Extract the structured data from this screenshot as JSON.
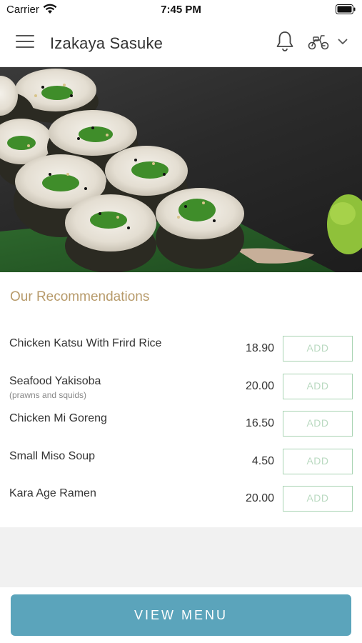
{
  "status_bar": {
    "carrier": "Carrier",
    "time": "7:45 PM"
  },
  "header": {
    "title": "Izakaya Sasuke",
    "icons": [
      "menu-icon",
      "bell-icon",
      "scooter-icon",
      "chevron-down-icon"
    ]
  },
  "recommendations": {
    "title": "Our Recommendations",
    "add_label": "ADD",
    "items": [
      {
        "name": "Chicken Katsu With Frird Rice",
        "subtitle": "",
        "price": "18.90"
      },
      {
        "name": "Seafood Yakisoba",
        "subtitle": "(prawns and squids)",
        "price": "20.00"
      },
      {
        "name": "Chicken Mi Goreng",
        "subtitle": "",
        "price": "16.50"
      },
      {
        "name": "Small Miso Soup",
        "subtitle": "",
        "price": "4.50"
      },
      {
        "name": "Kara Age Ramen",
        "subtitle": "",
        "price": "20.00"
      }
    ]
  },
  "footer": {
    "view_menu_label": "VIEW MENU"
  },
  "colors": {
    "accent": "#5ba4bb",
    "section_title": "#b79a6a",
    "add_border": "#a8d3b2"
  }
}
